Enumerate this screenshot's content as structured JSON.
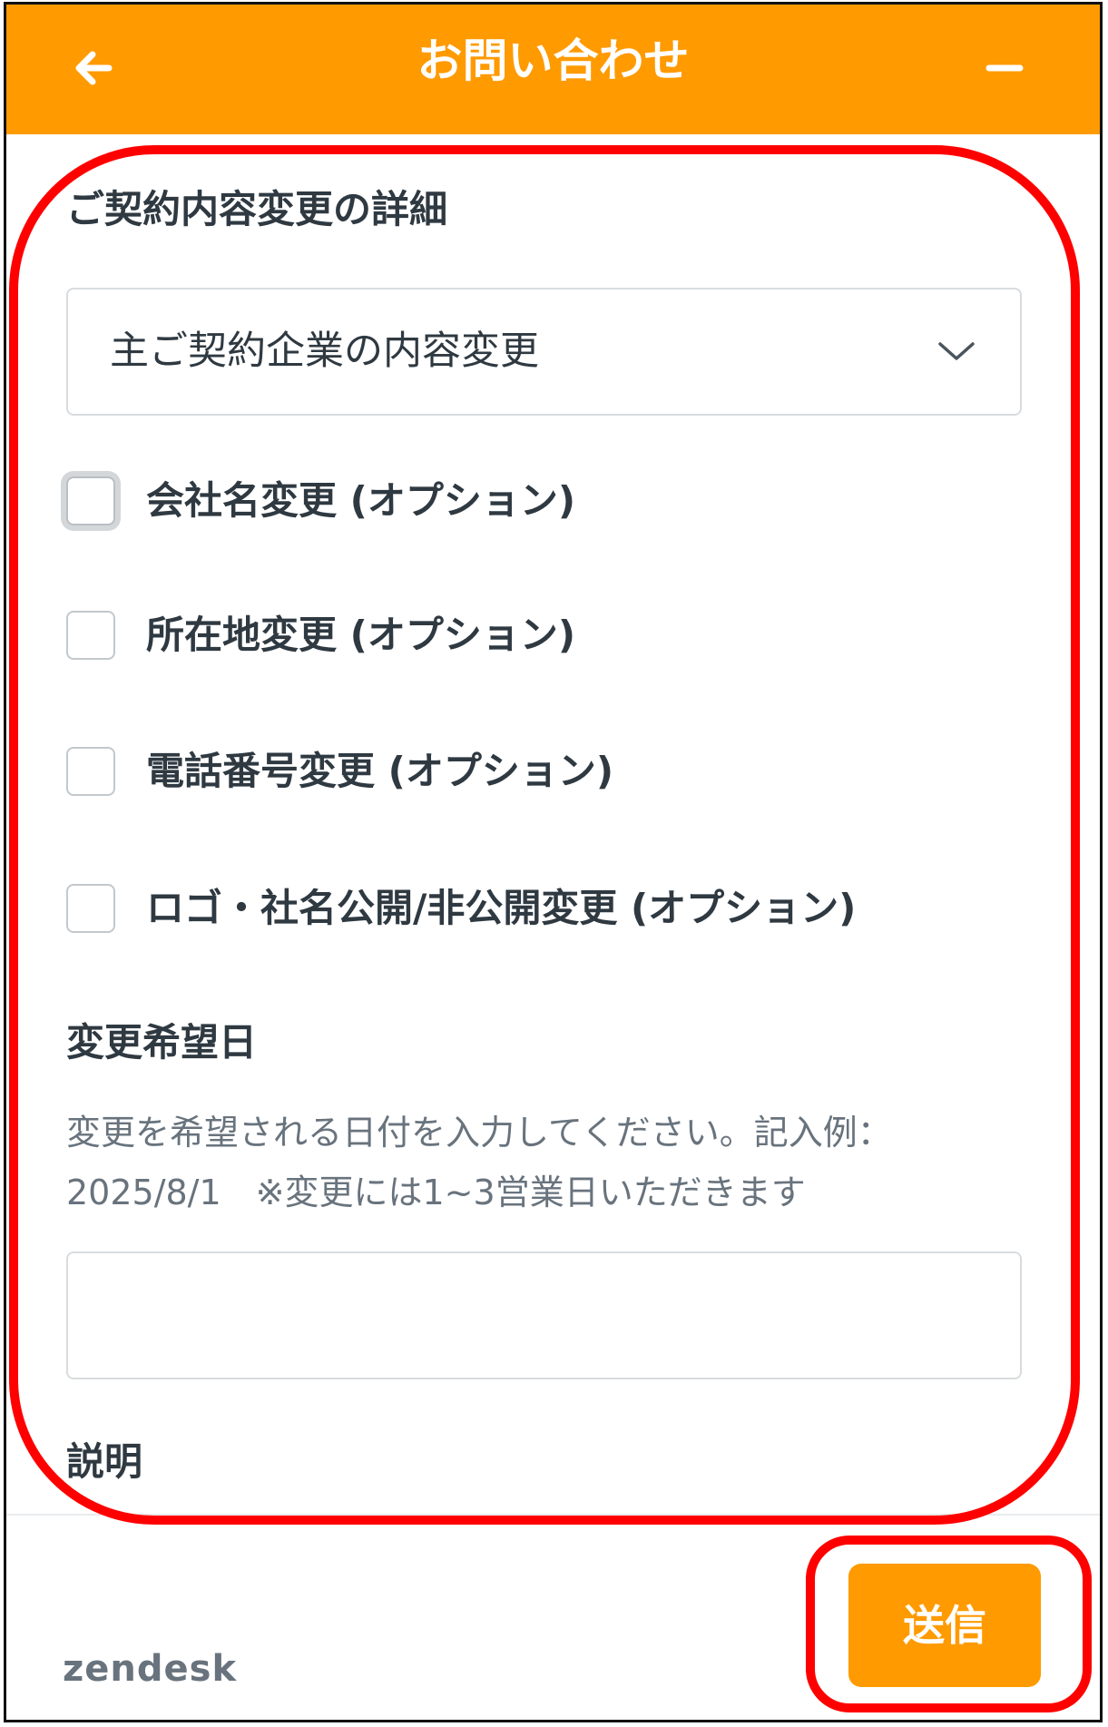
{
  "header": {
    "title": "お問い合わせ",
    "back_icon": "arrow-left-icon",
    "minimize_icon": "minus-icon",
    "color": "#ff9a00"
  },
  "form": {
    "details_label": "ご契約内容変更の詳細",
    "details_select_value": "主ご契約企業の内容変更",
    "checkboxes": [
      {
        "label": "会社名変更 (オプション)",
        "checked": false
      },
      {
        "label": "所在地変更 (オプション)",
        "checked": false
      },
      {
        "label": "電話番号変更 (オプション)",
        "checked": false
      },
      {
        "label": "ロゴ・社名公開/非公開変更 (オプション)",
        "checked": false
      }
    ],
    "date_label": "変更希望日",
    "date_hint": "変更を希望される日付を入力してください。記入例：2025/8/1　※変更には1~3営業日いただきます",
    "date_value": "",
    "description_label": "説明"
  },
  "footer": {
    "brand": "zendesk",
    "send_label": "送信"
  },
  "annotation": {
    "highlight_color": "#ff0000"
  }
}
